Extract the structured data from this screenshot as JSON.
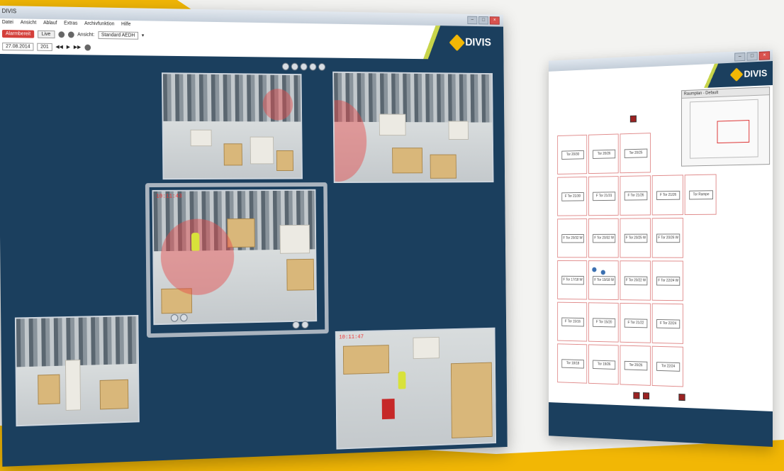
{
  "colors": {
    "brand_blue": "#1b3f5e",
    "accent_yellow": "#f2b705",
    "alarm_red": "#e64646",
    "logo_green": "#c7d44a"
  },
  "back_window": {
    "logo_text": "DIVIS",
    "minimap_title": "Raumplan - Default",
    "map_labels": [
      "Tor 20/30",
      "Tor 20/26",
      "Tor 20/25",
      "F Tor 21/30",
      "F Tor 21/31",
      "F Tor 21/26",
      "F Tor 21/26",
      "Tor Rampe",
      "F Tor 20/32 W",
      "F Tor 20/32 W",
      "F Tor 20/25 W",
      "F Tor 20/26 W",
      "F Tor 17/18 W",
      "F Tor 19/18 W",
      "F Tor 20/22 W",
      "F Tor 22/24 W",
      "F Tor 15/16",
      "F Tor 15/20",
      "F Tor 21/22",
      "F Tor 22/24",
      "Tor 18/18",
      "Tor 19/26",
      "Tor 20/26",
      "Tor 22/24"
    ]
  },
  "front_window": {
    "title": "DIVIS",
    "menu": [
      "Datei",
      "Ansicht",
      "Ablauf",
      "Extras",
      "Archivfunktion",
      "Hilfe"
    ],
    "toolbar": {
      "live_button": "Alarmbereit",
      "stop_button": "Live",
      "view_label": "Ansicht:",
      "view_value": "Standard AEDH",
      "timestamp": "27.08.2014",
      "field_value": "201"
    },
    "logo_text": "DIVIS",
    "cameras": [
      {
        "id": "cam-top",
        "timestamp": ""
      },
      {
        "id": "cam-top-right",
        "timestamp": ""
      },
      {
        "id": "cam-center",
        "timestamp": "10:11:43"
      },
      {
        "id": "cam-bottom-left",
        "timestamp": ""
      },
      {
        "id": "cam-bottom-right",
        "timestamp": "10:11:47"
      }
    ]
  }
}
